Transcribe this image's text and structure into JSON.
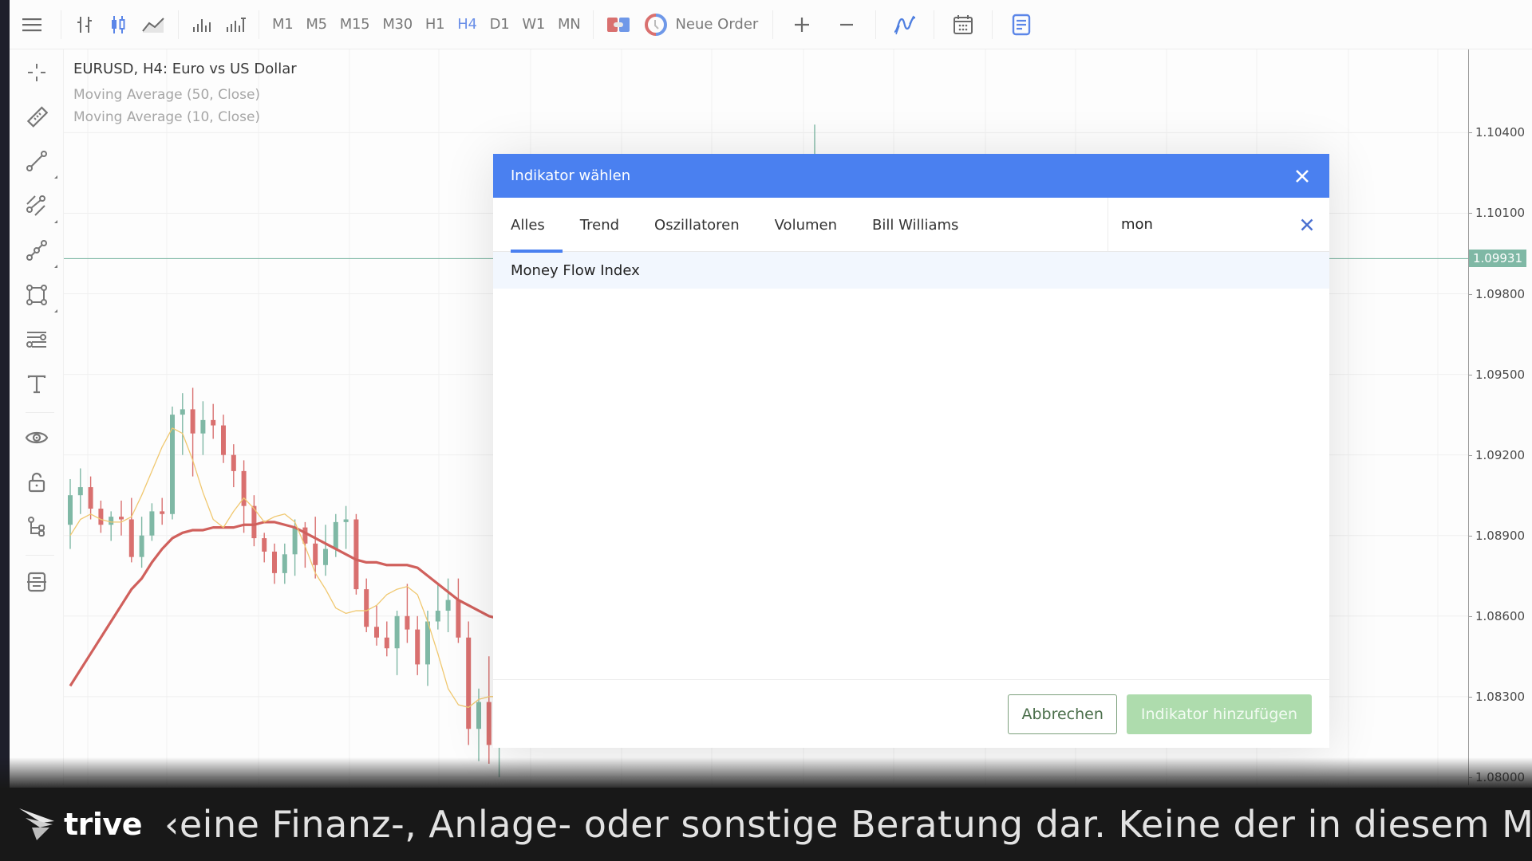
{
  "toolbar": {
    "timeframes": [
      "M1",
      "M5",
      "M15",
      "M30",
      "H1",
      "H4",
      "D1",
      "W1",
      "MN"
    ],
    "active_timeframe": "H4",
    "neue_order_label": "Neue Order",
    "icons": [
      "menu-icon",
      "bar-chart-icon",
      "candlestick-icon",
      "line-chart-icon",
      "volume-icon",
      "volume-tick-icon",
      "one-click-trading-icon",
      "clock-icon",
      "zoom-in-icon",
      "zoom-out-icon",
      "indicators-icon",
      "calendar-icon",
      "news-icon"
    ]
  },
  "sidebar": {
    "tools": [
      "crosshair-icon",
      "ruler-icon",
      "trendline-icon",
      "channel-icon",
      "polyline-icon",
      "shapes-icon",
      "fibonacci-icon",
      "text-icon",
      "eye-icon",
      "lock-icon",
      "object-tree-icon",
      "layers-icon"
    ]
  },
  "chart": {
    "symbol_title": "EURUSD, H4: Euro vs US Dollar",
    "indicators": [
      "Moving Average (50, Close)",
      "Moving Average (10, Close)"
    ],
    "current_price": "1.09931",
    "colors": {
      "up": "#7fb8a5",
      "down": "#d9706f",
      "ma50": "#d0605c",
      "ma10": "#f0c870",
      "current_line": "#7fb8a5"
    }
  },
  "chart_data": {
    "type": "candlestick",
    "title": "EURUSD, H4: Euro vs US Dollar",
    "y_axis": {
      "ticks": [
        "1.10400",
        "1.10100",
        "1.09800",
        "1.09500",
        "1.09200",
        "1.08900",
        "1.08600",
        "1.08300",
        "1.08000"
      ],
      "range": [
        1.0797,
        1.1071
      ]
    },
    "current_price": 1.09931,
    "series": [
      {
        "name": "Moving Average (50, Close)",
        "color": "#d0605c",
        "values": [
          1.0834,
          1.084,
          1.0846,
          1.0852,
          1.0858,
          1.0864,
          1.087,
          1.0874,
          1.088,
          1.0885,
          1.0889,
          1.0891,
          1.0892,
          1.0892,
          1.0893,
          1.0893,
          1.0893,
          1.0894,
          1.0894,
          1.0895,
          1.0895,
          1.0894,
          1.0893,
          1.0891,
          1.0889,
          1.0887,
          1.0885,
          1.0883,
          1.0881,
          1.088,
          1.088,
          1.0879,
          1.0879,
          1.0879,
          1.0878,
          1.0875,
          1.0872,
          1.0869,
          1.0866,
          1.0864,
          1.0862,
          1.086,
          1.0859
        ]
      },
      {
        "name": "Moving Average (10, Close)",
        "color": "#f0c870",
        "values": [
          1.089,
          1.0896,
          1.0898,
          1.0896,
          1.0895,
          1.0895,
          1.0897,
          1.0905,
          1.0914,
          1.0923,
          1.093,
          1.0928,
          1.0918,
          1.0906,
          1.0896,
          1.0893,
          1.0899,
          1.0904,
          1.09,
          1.0895,
          1.0897,
          1.0898,
          1.0895,
          1.0886,
          1.0876,
          1.087,
          1.0863,
          1.0861,
          1.0862,
          1.0862,
          1.0864,
          1.0868,
          1.087,
          1.0871,
          1.0868,
          1.0858,
          1.0846,
          1.0833,
          1.0827,
          1.0826,
          1.0829,
          1.083,
          1.083
        ]
      }
    ],
    "ohlc": [
      [
        1.0894,
        1.0911,
        1.0885,
        1.0905
      ],
      [
        1.0905,
        1.0915,
        1.0898,
        1.0908
      ],
      [
        1.0908,
        1.0912,
        1.0896,
        1.09
      ],
      [
        1.09,
        1.0903,
        1.0891,
        1.0894
      ],
      [
        1.0894,
        1.0899,
        1.0888,
        1.0897
      ],
      [
        1.0897,
        1.0903,
        1.089,
        1.0896
      ],
      [
        1.0896,
        1.0904,
        1.088,
        1.0882
      ],
      [
        1.0882,
        1.0897,
        1.0878,
        1.089
      ],
      [
        1.089,
        1.0902,
        1.0888,
        1.0899
      ],
      [
        1.0899,
        1.0904,
        1.0894,
        1.0898
      ],
      [
        1.0898,
        1.0938,
        1.0896,
        1.0935
      ],
      [
        1.0935,
        1.0943,
        1.092,
        1.0937
      ],
      [
        1.0937,
        1.0945,
        1.0912,
        1.0928
      ],
      [
        1.0928,
        1.094,
        1.092,
        1.0933
      ],
      [
        1.0933,
        1.0939,
        1.0926,
        1.0931
      ],
      [
        1.0931,
        1.0935,
        1.0917,
        1.092
      ],
      [
        1.092,
        1.0924,
        1.0908,
        1.0914
      ],
      [
        1.0914,
        1.0918,
        1.0891,
        1.0901
      ],
      [
        1.0901,
        1.0905,
        1.0886,
        1.0889
      ],
      [
        1.0889,
        1.0891,
        1.088,
        1.0884
      ],
      [
        1.0884,
        1.0887,
        1.0872,
        1.0876
      ],
      [
        1.0876,
        1.0887,
        1.0872,
        1.0883
      ],
      [
        1.0883,
        1.0896,
        1.0875,
        1.0893
      ],
      [
        1.0893,
        1.0895,
        1.0878,
        1.0887
      ],
      [
        1.0887,
        1.0897,
        1.0874,
        1.0879
      ],
      [
        1.0879,
        1.0894,
        1.0875,
        1.0885
      ],
      [
        1.0885,
        1.0898,
        1.0882,
        1.0895
      ],
      [
        1.0895,
        1.0901,
        1.0885,
        1.0896
      ],
      [
        1.0896,
        1.0898,
        1.0868,
        1.087
      ],
      [
        1.087,
        1.0874,
        1.0854,
        1.0856
      ],
      [
        1.0856,
        1.0864,
        1.0849,
        1.0852
      ],
      [
        1.0852,
        1.0858,
        1.0845,
        1.0848
      ],
      [
        1.0848,
        1.0862,
        1.0838,
        1.086
      ],
      [
        1.086,
        1.0872,
        1.085,
        1.0855
      ],
      [
        1.0855,
        1.086,
        1.0838,
        1.0842
      ],
      [
        1.0842,
        1.0862,
        1.0834,
        1.0858
      ],
      [
        1.0858,
        1.0872,
        1.0855,
        1.0862
      ],
      [
        1.0862,
        1.0874,
        1.0854,
        1.0866
      ],
      [
        1.0866,
        1.0874,
        1.085,
        1.0852
      ],
      [
        1.0852,
        1.0858,
        1.0812,
        1.0818
      ],
      [
        1.0818,
        1.0833,
        1.0806,
        1.0828
      ],
      [
        1.0828,
        1.0845,
        1.0805,
        1.0812
      ],
      [
        1.0812,
        1.084,
        1.08,
        1.0835
      ]
    ]
  },
  "dialog": {
    "title": "Indikator wählen",
    "tabs": [
      "Alles",
      "Trend",
      "Oszillatoren",
      "Volumen",
      "Bill Williams"
    ],
    "active_tab": "Alles",
    "search": {
      "value": "mon",
      "placeholder": ""
    },
    "results": [
      "Money Flow Index"
    ],
    "cancel_label": "Abbrechen",
    "add_label": "Indikator hinzufügen",
    "accent": "#4a80f0"
  },
  "banner": {
    "logo_text": "trive",
    "ticker_text": "‹eine Finanz-, Anlage- oder sonstige Beratung dar. Keine der in diesem Ma"
  }
}
